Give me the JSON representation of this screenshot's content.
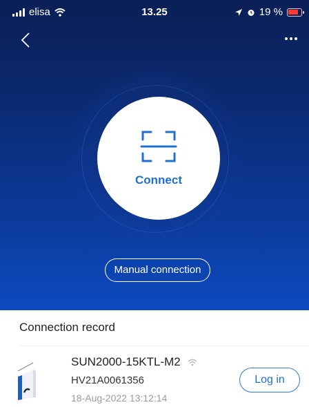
{
  "status_bar": {
    "carrier": "elisa",
    "time": "13.25",
    "battery_percent": "19 %"
  },
  "hero": {
    "connect_label": "Connect",
    "manual_connection_label": "Manual connection"
  },
  "connection_record": {
    "title": "Connection record",
    "items": [
      {
        "name": "SUN2000-15KTL-M2",
        "serial": "HV21A0061356",
        "timestamp": "18-Aug-2022 13:12:14",
        "action_label": "Log in"
      }
    ]
  },
  "icons": {
    "back": "chevron-left-icon",
    "more": "ellipsis-icon",
    "scan": "scan-frame-icon",
    "wifi": "wifi-icon",
    "device": "inverter-device-icon"
  },
  "colors": {
    "hero_top": "#0a1f55",
    "hero_bottom": "#0d4bc0",
    "accent": "#1f6fd1",
    "battery_low": "#ff3b30"
  }
}
